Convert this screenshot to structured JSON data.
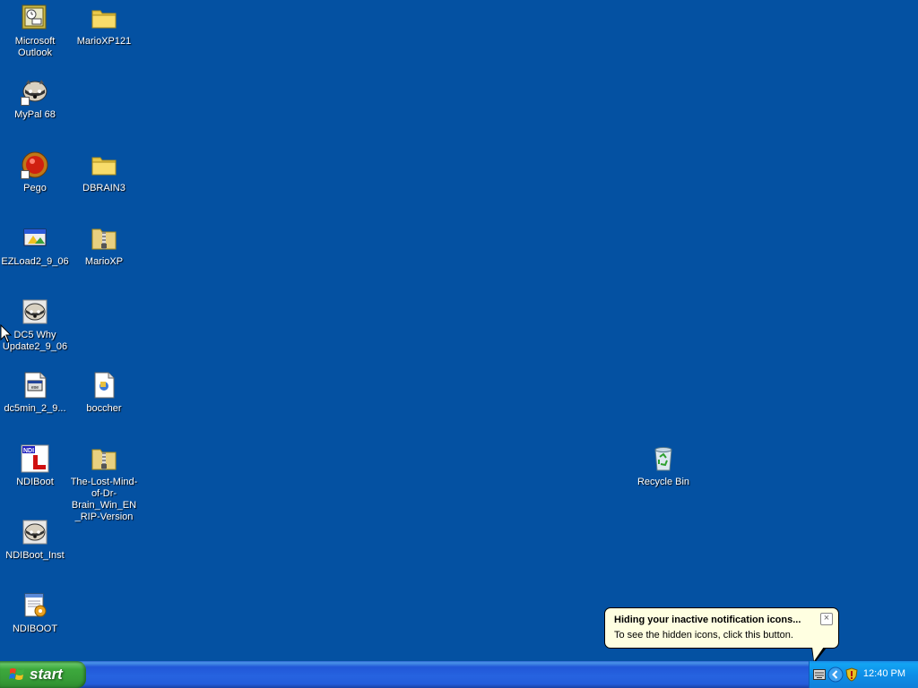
{
  "desktop": {
    "icons": [
      {
        "label": "Microsoft Outlook",
        "icon": "outlook-icon"
      },
      {
        "label": "MarioXP121",
        "icon": "folder-icon"
      },
      {
        "label": "MyPal 68",
        "icon": "raccoon-icon"
      },
      {
        "label": "Pego",
        "icon": "red-ball-icon"
      },
      {
        "label": "DBRAIN3",
        "icon": "folder-icon"
      },
      {
        "label": "EZLoad2_9_06",
        "icon": "ezload-icon"
      },
      {
        "label": "MarioXP",
        "icon": "zip-folder-icon"
      },
      {
        "label": "DC5 Why Update2_9_06",
        "icon": "raccoon-icon"
      },
      {
        "label": "dc5min_2_9...",
        "icon": "exe-file-icon"
      },
      {
        "label": "boccher",
        "icon": "document-icon"
      },
      {
        "label": "NDIBoot",
        "icon": "ndi-icon"
      },
      {
        "label": "The-Lost-Mind-of-Dr-Brain_Win_EN_RIP-Version",
        "icon": "zip-folder-icon"
      },
      {
        "label": "NDIBoot_Inst",
        "icon": "raccoon-icon"
      },
      {
        "label": "NDIBOOT",
        "icon": "notepad-gear-icon"
      },
      {
        "label": "Recycle Bin",
        "icon": "recycle-bin-icon"
      }
    ]
  },
  "taskbar": {
    "start_label": "start",
    "clock": "12:40 PM"
  },
  "balloon": {
    "title": "Hiding your inactive notification icons...",
    "text": "To see the hidden icons, click this button.",
    "close_glyph": "×"
  },
  "colors": {
    "desktop": "#0451a2",
    "taskbar": "#245ddb",
    "start": "#3da93d",
    "tray": "#0d8fe8",
    "balloon": "#ffffe1"
  }
}
